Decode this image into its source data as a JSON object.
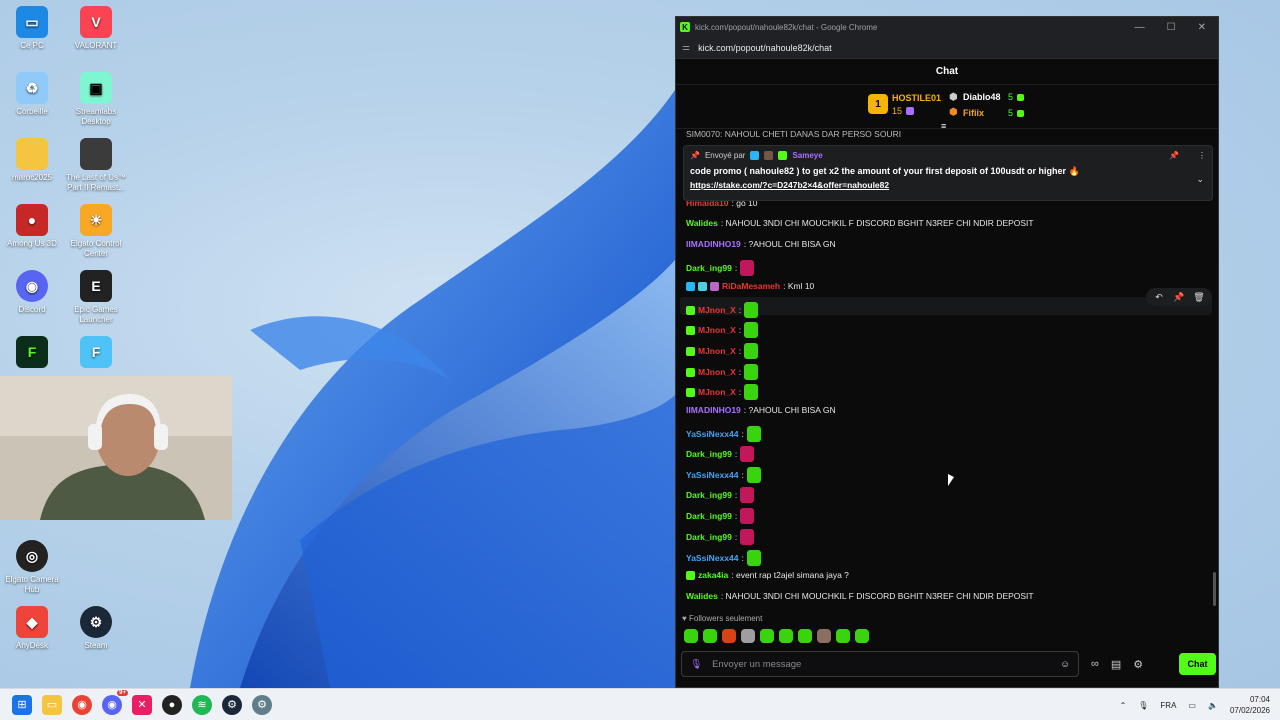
{
  "desktop": {
    "icons": [
      {
        "label": "Ce PC",
        "name": "this-pc-icon",
        "color": "#1e88e5"
      },
      {
        "label": "VALORANT",
        "name": "valorant-icon",
        "color": "#fa4454"
      },
      {
        "label": "Corbeille",
        "name": "recycle-bin-icon",
        "color": "#90caf9"
      },
      {
        "label": "Streamlabs Desktop",
        "name": "streamlabs-icon",
        "color": "#80f5d2"
      },
      {
        "label": "maroc2025",
        "name": "folder-icon",
        "color": "#f5c542"
      },
      {
        "label": "The Last of Us™ Part II Remast...",
        "name": "tlou-icon",
        "color": "#3b3b3b"
      },
      {
        "label": "Among Us 3D",
        "name": "among-us-icon",
        "color": "#c62828"
      },
      {
        "label": "Elgato Control Center",
        "name": "elgato-control-icon",
        "color": "#f9a825"
      },
      {
        "label": "Discord",
        "name": "discord-icon",
        "color": "#5865f2"
      },
      {
        "label": "Epic Games Launcher",
        "name": "epic-games-icon",
        "color": "#222222"
      },
      {
        "label": "Elgato Camera Hub",
        "name": "elgato-camera-icon",
        "color": "#222222"
      },
      {
        "label": "AnyDesk",
        "name": "anydesk-icon",
        "color": "#ef443b"
      },
      {
        "label": "Steam",
        "name": "steam-icon",
        "color": "#1b2838"
      }
    ]
  },
  "window": {
    "title": "kick.com/popout/nahoule82k/chat - Google Chrome",
    "url": "kick.com/popout/nahoule82k/chat",
    "controls": {
      "minimize": "—",
      "maximize": "☐",
      "close": "✕"
    }
  },
  "chat": {
    "header": "Chat",
    "leaderboard": {
      "first": {
        "rank": "1",
        "name": "HOSTILE01",
        "count": "15"
      },
      "second": {
        "name": "Diablo48",
        "count": "5"
      },
      "third": {
        "name": "Fifiix",
        "count": "5"
      }
    },
    "partial_top": "SIM0070: NAHOUL CHETI DANAS DAR PERSO SOURI",
    "pinned": {
      "sent_by_label": "Envoyé par",
      "sender": "Sameye",
      "text": "code promo ( nahoule82 ) to get x2 the amount of your first deposit of 100usdt or higher 🔥",
      "link": "https://stake.com/?c=D247b2×4&offer=nahoule82"
    },
    "messages": [
      {
        "user": "Himaida10",
        "text": ": go 10",
        "color": "#e53935"
      },
      {
        "user": "Walides",
        "text": ": NAHOUL 3NDI CHI MOUCHKIL F DISCORD BGHIT N3REF CHI NDIR DEPOSIT",
        "color": "#53fc18"
      },
      {
        "user": "IIMADINHO19",
        "text": ": ?AHOUL CHI BISA GN",
        "color": "#a970ff"
      },
      {
        "user": "Dark_ing99",
        "text": ":",
        "color": "#53fc18"
      },
      {
        "user": "RiDaMesameh",
        "text": ": Kml 10",
        "color": "#e53935"
      },
      {
        "user": "MJnon_X",
        "text": ":",
        "color": "#e53935"
      },
      {
        "user": "MJnon_X",
        "text": ":",
        "color": "#e53935"
      },
      {
        "user": "MJnon_X",
        "text": ":",
        "color": "#e53935"
      },
      {
        "user": "MJnon_X",
        "text": ":",
        "color": "#e53935"
      },
      {
        "user": "MJnon_X",
        "text": ":",
        "color": "#e53935"
      },
      {
        "user": "IIMADINHO19",
        "text": ": ?AHOUL CHI BISA GN",
        "color": "#a970ff"
      },
      {
        "user": "YaSsiNexx44",
        "text": ":",
        "color": "#42a5f5"
      },
      {
        "user": "Dark_ing99",
        "text": ":",
        "color": "#53fc18"
      },
      {
        "user": "YaSsiNexx44",
        "text": ":",
        "color": "#42a5f5"
      },
      {
        "user": "Dark_ing99",
        "text": ":",
        "color": "#53fc18"
      },
      {
        "user": "Dark_ing99",
        "text": ":",
        "color": "#53fc18"
      },
      {
        "user": "Dark_ing99",
        "text": ":",
        "color": "#53fc18"
      },
      {
        "user": "YaSsiNexx44",
        "text": ":",
        "color": "#42a5f5"
      },
      {
        "user": "zaka4ia",
        "text": ": event rap t2ajel simana jaya ?",
        "color": "#53fc18"
      },
      {
        "user": "Walides",
        "text": ": NAHOUL 3NDI CHI MOUCHKIL F DISCORD BGHIT N3REF CHI NDIR DEPOSIT",
        "color": "#53fc18"
      }
    ],
    "followers_only": "Followers seulement",
    "composer_placeholder": "Envoyer un message",
    "send_label": "Chat"
  },
  "taskbar": {
    "language": "FRA",
    "time": "07:04",
    "date": "07/02/2026",
    "discord_badge": "9+"
  }
}
